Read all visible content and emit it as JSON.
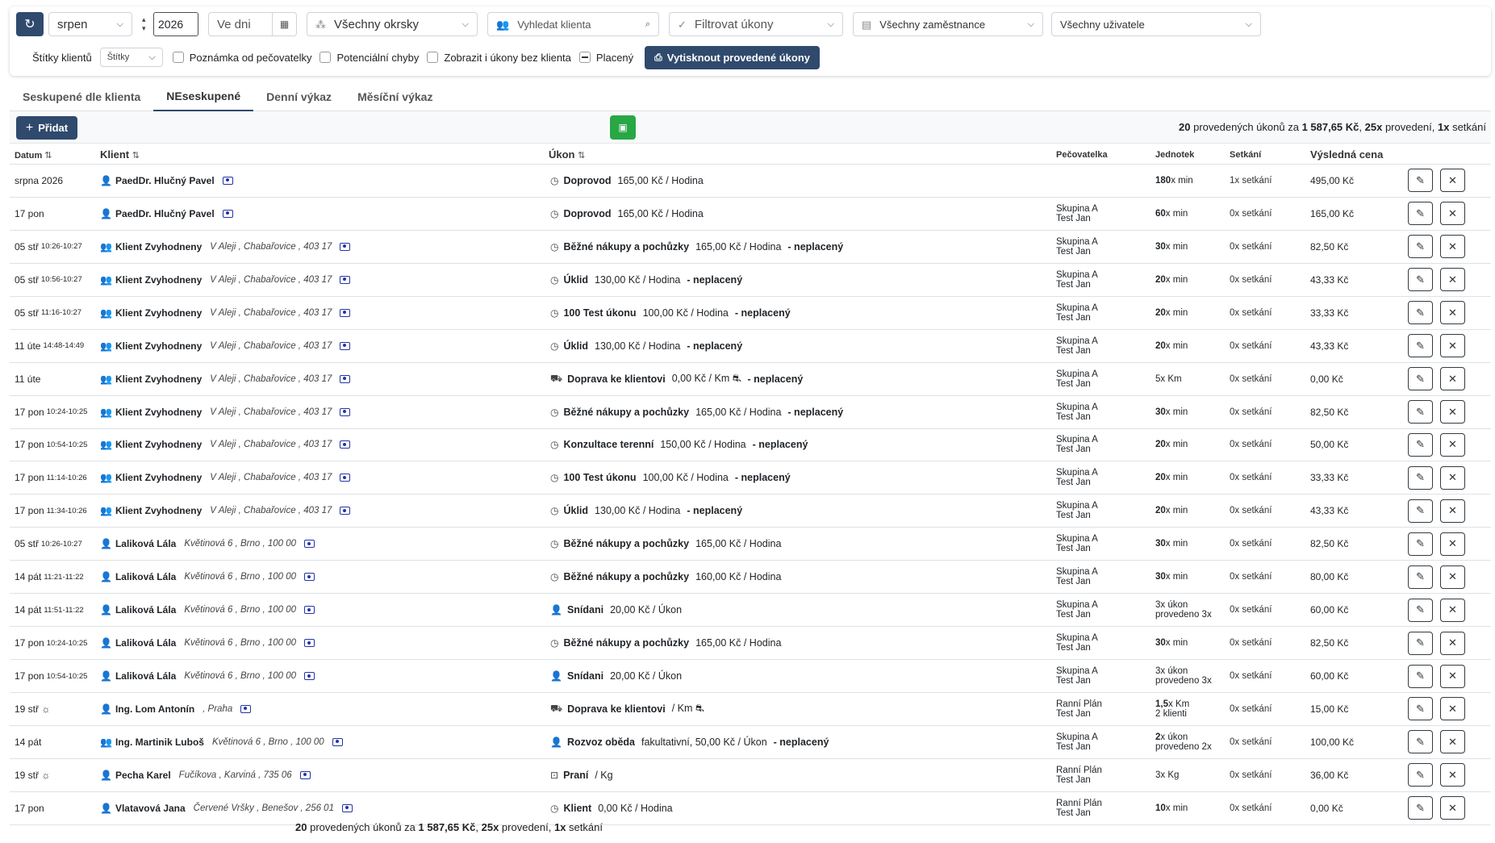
{
  "filters": {
    "month": "srpen",
    "year": "2026",
    "days_placeholder": "Ve dni",
    "district": "Všechny okrsky",
    "client_search_placeholder": "Vyhledat klienta",
    "actions_filter": "Filtrovat úkony",
    "employees": "Všechny zaměstnance",
    "users": "Všechny uživatele",
    "tags_label": "Štítky klientů",
    "tags_select": "Štítky",
    "chk_note": "Poznámka od pečovatelky",
    "chk_errors": "Potenciální chyby",
    "chk_no_client": "Zobrazit i úkony bez klienta",
    "chk_paid": "Placený",
    "print_button": "Vytisknout provedené úkony"
  },
  "tabs": [
    "Seskupené dle klienta",
    "NEseskupené",
    "Denní výkaz",
    "Měsíční výkaz"
  ],
  "toolbar": {
    "add_label": "Přidat",
    "summary": {
      "count": "20",
      "t1": " provedených úkonů za ",
      "amount": "1 587,65 Kč",
      "t2": ", ",
      "exec": "25x",
      "t3": " provedení, ",
      "meet": "1x",
      "t4": " setkání"
    }
  },
  "headers": {
    "date": "Datum",
    "client": "Klient",
    "ukon": "Úkon",
    "pec": "Pečovatelka",
    "jed": "Jednotek",
    "set": "Setkání",
    "price": "Výsledná cena"
  },
  "icons": {
    "refresh": "refresh-icon",
    "calendar": "calendar-icon",
    "edit": "pencil-icon",
    "delete": "x-icon"
  },
  "rows": [
    {
      "date": "srpna 2026",
      "time": "",
      "cicon": "single",
      "client": "PaedDr. Hlučný Pavel",
      "addr": "",
      "uicon": "clock",
      "ukon": "Doprovod",
      "price": "165,00 Kč / Hodina",
      "unpaid": "",
      "pec1": "",
      "pec2": "",
      "jb": "180",
      "jr": "x min",
      "j2": "",
      "set": "1x setkání",
      "total": "495,00 Kč"
    },
    {
      "date": "17 pon",
      "time": "",
      "cicon": "single",
      "client": "PaedDr. Hlučný Pavel",
      "addr": "",
      "uicon": "clock",
      "ukon": "Doprovod",
      "price": "165,00 Kč / Hodina",
      "unpaid": "",
      "pec1": "Skupina A",
      "pec2": "Test Jan",
      "jb": "60",
      "jr": "x min",
      "j2": "",
      "set": "0x setkání",
      "total": "165,00 Kč"
    },
    {
      "date": "05 stř",
      "time": "10:26-10:27",
      "cicon": "multi",
      "client": "Klient Zvyhodneny",
      "addr": "V Aleji , Chabařovice , 403 17",
      "uicon": "clock",
      "ukon": "Běžné nákupy a pochůzky",
      "price": "165,00 Kč / Hodina",
      "unpaid": "- neplacený",
      "pec1": "Skupina A",
      "pec2": "Test Jan",
      "jb": "30",
      "jr": "x min",
      "j2": "",
      "set": "0x setkání",
      "total": "82,50 Kč"
    },
    {
      "date": "05 stř",
      "time": "10:56-10:27",
      "cicon": "multi",
      "client": "Klient Zvyhodneny",
      "addr": "V Aleji , Chabařovice , 403 17",
      "uicon": "clock",
      "ukon": "Úklid",
      "price": "130,00 Kč / Hodina",
      "unpaid": "- neplacený",
      "pec1": "Skupina A",
      "pec2": "Test Jan",
      "jb": "20",
      "jr": "x min",
      "j2": "",
      "set": "0x setkání",
      "total": "43,33 Kč"
    },
    {
      "date": "05 stř",
      "time": "11:16-10:27",
      "cicon": "multi",
      "client": "Klient Zvyhodneny",
      "addr": "V Aleji , Chabařovice , 403 17",
      "uicon": "clock",
      "ukon": "100 Test úkonu",
      "price": "100,00 Kč / Hodina",
      "unpaid": "- neplacený",
      "pec1": "Skupina A",
      "pec2": "Test Jan",
      "jb": "20",
      "jr": "x min",
      "j2": "",
      "set": "0x setkání",
      "total": "33,33 Kč"
    },
    {
      "date": "11 úte",
      "time": "14:48-14:49",
      "cicon": "multi",
      "client": "Klient Zvyhodneny",
      "addr": "V Aleji , Chabařovice , 403 17",
      "uicon": "clock",
      "ukon": "Úklid",
      "price": "130,00 Kč / Hodina",
      "unpaid": "- neplacený",
      "pec1": "Skupina A",
      "pec2": "Test Jan",
      "jb": "20",
      "jr": "x min",
      "j2": "",
      "set": "0x setkání",
      "total": "43,33 Kč"
    },
    {
      "date": "11 úte",
      "time": "",
      "cicon": "multi",
      "client": "Klient Zvyhodneny",
      "addr": "V Aleji , Chabařovice , 403 17",
      "uicon": "car",
      "ukon": "Doprava ke klientovi",
      "price": "0,00 Kč / Km ⛐",
      "unpaid": "- neplacený",
      "pec1": "Skupina A",
      "pec2": "Test Jan",
      "jb": "",
      "jr": "5x Km",
      "j2": "",
      "set": "0x setkání",
      "total": "0,00 Kč"
    },
    {
      "date": "17 pon",
      "time": "10:24-10:25",
      "cicon": "multi",
      "client": "Klient Zvyhodneny",
      "addr": "V Aleji , Chabařovice , 403 17",
      "uicon": "clock",
      "ukon": "Běžné nákupy a pochůzky",
      "price": "165,00 Kč / Hodina",
      "unpaid": "- neplacený",
      "pec1": "Skupina A",
      "pec2": "Test Jan",
      "jb": "30",
      "jr": "x min",
      "j2": "",
      "set": "0x setkání",
      "total": "82,50 Kč"
    },
    {
      "date": "17 pon",
      "time": "10:54-10:25",
      "cicon": "multi",
      "client": "Klient Zvyhodneny",
      "addr": "V Aleji , Chabařovice , 403 17",
      "uicon": "clock",
      "ukon": "Konzultace terenní",
      "price": "150,00 Kč / Hodina",
      "unpaid": "- neplacený",
      "pec1": "Skupina A",
      "pec2": "Test Jan",
      "jb": "20",
      "jr": "x min",
      "j2": "",
      "set": "0x setkání",
      "total": "50,00 Kč"
    },
    {
      "date": "17 pon",
      "time": "11:14-10:26",
      "cicon": "multi",
      "client": "Klient Zvyhodneny",
      "addr": "V Aleji , Chabařovice , 403 17",
      "uicon": "clock",
      "ukon": "100 Test úkonu",
      "price": "100,00 Kč / Hodina",
      "unpaid": "- neplacený",
      "pec1": "Skupina A",
      "pec2": "Test Jan",
      "jb": "20",
      "jr": "x min",
      "j2": "",
      "set": "0x setkání",
      "total": "33,33 Kč"
    },
    {
      "date": "17 pon",
      "time": "11:34-10:26",
      "cicon": "multi",
      "client": "Klient Zvyhodneny",
      "addr": "V Aleji , Chabařovice , 403 17",
      "uicon": "clock",
      "ukon": "Úklid",
      "price": "130,00 Kč / Hodina",
      "unpaid": "- neplacený",
      "pec1": "Skupina A",
      "pec2": "Test Jan",
      "jb": "20",
      "jr": "x min",
      "j2": "",
      "set": "0x setkání",
      "total": "43,33 Kč"
    },
    {
      "date": "05 stř",
      "time": "10:26-10:27",
      "cicon": "single",
      "client": "Laliková Lála",
      "addr": "Květinová 6 , Brno , 100 00",
      "uicon": "clock",
      "ukon": "Běžné nákupy a pochůzky",
      "price": "165,00 Kč / Hodina",
      "unpaid": "",
      "pec1": "Skupina A",
      "pec2": "Test Jan",
      "jb": "30",
      "jr": "x min",
      "j2": "",
      "set": "0x setkání",
      "total": "82,50 Kč"
    },
    {
      "date": "14 pát",
      "time": "11:21-11:22",
      "cicon": "single",
      "client": "Laliková Lála",
      "addr": "Květinová 6 , Brno , 100 00",
      "uicon": "clock",
      "ukon": "Běžné nákupy a pochůzky",
      "price": "160,00 Kč / Hodina",
      "unpaid": "",
      "pec1": "Skupina A",
      "pec2": "Test Jan",
      "jb": "30",
      "jr": "x min",
      "j2": "",
      "set": "0x setkání",
      "total": "80,00 Kč"
    },
    {
      "date": "14 pát",
      "time": "11:51-11:22",
      "cicon": "single",
      "client": "Laliková Lála",
      "addr": "Květinová 6 , Brno , 100 00",
      "uicon": "person",
      "ukon": "Snídani",
      "price": "20,00 Kč / Úkon",
      "unpaid": "",
      "pec1": "Skupina A",
      "pec2": "Test Jan",
      "jb": "",
      "jr": "3x úkon",
      "j2": "provedeno 3x",
      "set": "0x setkání",
      "total": "60,00 Kč"
    },
    {
      "date": "17 pon",
      "time": "10:24-10:25",
      "cicon": "single",
      "client": "Laliková Lála",
      "addr": "Květinová 6 , Brno , 100 00",
      "uicon": "clock",
      "ukon": "Běžné nákupy a pochůzky",
      "price": "165,00 Kč / Hodina",
      "unpaid": "",
      "pec1": "Skupina A",
      "pec2": "Test Jan",
      "jb": "30",
      "jr": "x min",
      "j2": "",
      "set": "0x setkání",
      "total": "82,50 Kč"
    },
    {
      "date": "17 pon",
      "time": "10:54-10:25",
      "cicon": "single",
      "client": "Laliková Lála",
      "addr": "Květinová 6 , Brno , 100 00",
      "uicon": "person",
      "ukon": "Snídani",
      "price": "20,00 Kč / Úkon",
      "unpaid": "",
      "pec1": "Skupina A",
      "pec2": "Test Jan",
      "jb": "",
      "jr": "3x úkon",
      "j2": "provedeno 3x",
      "set": "0x setkání",
      "total": "60,00 Kč"
    },
    {
      "date": "19 stř ☼",
      "time": "",
      "cicon": "single",
      "client": "Ing. Lom Antonín",
      "addr": ", Praha",
      "uicon": "car",
      "ukon": "Doprava ke klientovi",
      "price": "/ Km ⛐",
      "unpaid": "",
      "pec1": "Ranní Plán",
      "pec2": "Test Jan",
      "jb": "1,5",
      "jr": "x Km",
      "j2": "2 klienti",
      "set": "0x setkání",
      "total": "15,00 Kč"
    },
    {
      "date": "14 pát",
      "time": "",
      "cicon": "multi",
      "client": "Ing. Martinik Luboš",
      "addr": "Květinová 6 , Brno , 100 00",
      "uicon": "person",
      "ukon": "Rozvoz oběda",
      "price": "fakultativní, 50,00 Kč / Úkon",
      "unpaid": "- neplacený",
      "pec1": "Skupina A",
      "pec2": "Test Jan",
      "jb": "2",
      "jr": "x úkon",
      "j2": "provedeno 2x",
      "set": "0x setkání",
      "total": "100,00 Kč"
    },
    {
      "date": "19 stř ☼",
      "time": "",
      "cicon": "single",
      "client": "Pecha Karel",
      "addr": "Fučíkova , Karviná , 735 06",
      "uicon": "wash",
      "ukon": "Praní",
      "price": "/ Kg",
      "unpaid": "",
      "pec1": "Ranní Plán",
      "pec2": "Test Jan",
      "jb": "",
      "jr": "3x Kg",
      "j2": "",
      "set": "0x setkání",
      "total": "36,00 Kč"
    },
    {
      "date": "17 pon",
      "time": "",
      "cicon": "single",
      "client": "Vlatavová Jana",
      "addr": "Červené Vršky , Benešov , 256 01",
      "uicon": "clock",
      "ukon": "Klient",
      "price": "0,00 Kč / Hodina",
      "unpaid": "",
      "pec1": "Ranní Plán",
      "pec2": "Test Jan",
      "jb": "10",
      "jr": "x min",
      "j2": "",
      "set": "0x setkání",
      "total": "0,00 Kč"
    }
  ]
}
